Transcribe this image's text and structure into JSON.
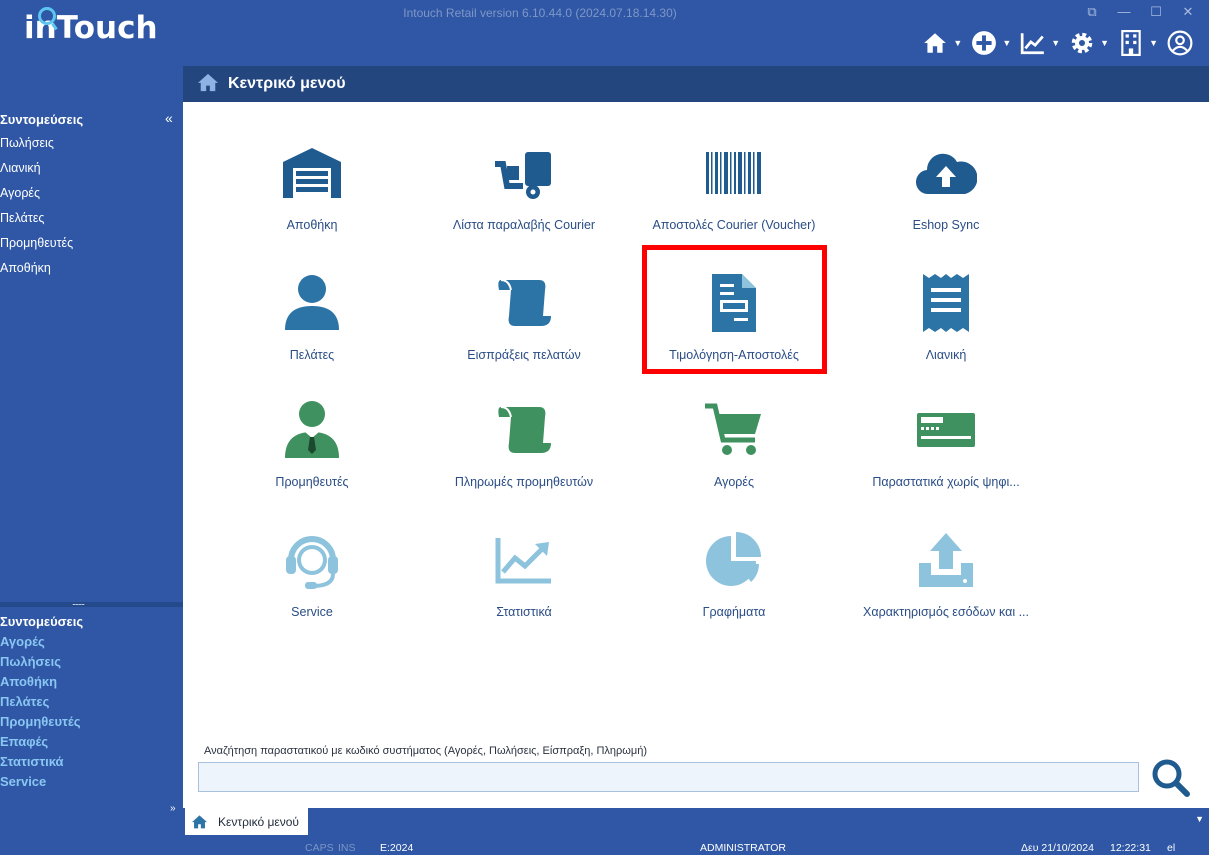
{
  "window": {
    "title": "Intouch Retail version 6.10.44.0 (2024.07.18.14.30)",
    "controls": [
      "restore-down-icon",
      "minimize-icon",
      "maximize-icon",
      "close-icon"
    ]
  },
  "logo": {
    "text": "inTouch"
  },
  "toolbar": {
    "icons": [
      "home-icon",
      "add-icon",
      "chart-icon",
      "gear-icon",
      "building-icon",
      "user-icon"
    ]
  },
  "header": {
    "title": "Κεντρικό μενού"
  },
  "sidebar": {
    "heading": "Συντομεύσεις",
    "collapse_glyph": "«",
    "items": [
      "Πωλήσεις",
      "Λιανική",
      "Αγορές",
      "Πελάτες",
      "Προμηθευτές",
      "Αποθήκη"
    ],
    "splitter_glyph": "........",
    "heading2": "Συντομεύσεις",
    "items2": [
      "Αγορές",
      "Πωλήσεις",
      "Αποθήκη",
      "Πελάτες",
      "Προμηθευτές",
      "Επαφές",
      "Στατιστικά",
      "Service"
    ]
  },
  "tiles": [
    {
      "label": "Αποθήκη",
      "icon": "warehouse-icon",
      "color": "#1f5b8e"
    },
    {
      "label": "Λίστα παραλαβής Courier",
      "icon": "hand-truck-icon",
      "color": "#1f5b8e"
    },
    {
      "label": "Αποστολές Courier (Voucher)",
      "icon": "barcode-icon",
      "color": "#1f5b8e"
    },
    {
      "label": "Eshop Sync",
      "icon": "cloud-upload-icon",
      "color": "#1f5b8e"
    },
    {
      "label": "Πελάτες",
      "icon": "user-icon",
      "color": "#2c73a6"
    },
    {
      "label": "Εισπράξεις πελατών",
      "icon": "scroll-icon",
      "color": "#2c73a6"
    },
    {
      "label": "Τιμολόγηση-Αποστολές",
      "icon": "invoice-icon",
      "color": "#2c73a6"
    },
    {
      "label": "Λιανική",
      "icon": "receipt-icon",
      "color": "#2c73a6"
    },
    {
      "label": "Προμηθευτές",
      "icon": "supplier-icon",
      "color": "#3f9160"
    },
    {
      "label": "Πληρωμές προμηθευτών",
      "icon": "scroll-icon",
      "color": "#3f9160"
    },
    {
      "label": "Αγορές",
      "icon": "cart-icon",
      "color": "#3f9160"
    },
    {
      "label": "Παραστατικά χωρίς ψηφι...",
      "icon": "card-reader-icon",
      "color": "#3f9160"
    },
    {
      "label": "Service",
      "icon": "headset-icon",
      "color": "#8ec3de"
    },
    {
      "label": "Στατιστικά",
      "icon": "line-chart-icon",
      "color": "#8ec3de"
    },
    {
      "label": "Γραφήματα",
      "icon": "pie-chart-icon",
      "color": "#8ec3de"
    },
    {
      "label": "Χαρακτηρισμός εσόδων και ...",
      "icon": "upload-tray-icon",
      "color": "#8ec3de"
    }
  ],
  "search": {
    "label": "Αναζήτηση παραστατικού με κωδικό συστήματος (Αγορές, Πωλήσεις, Είσπραξη, Πληρωμή)",
    "value": "",
    "placeholder": ""
  },
  "tab": {
    "label": "Κεντρικό μενού"
  },
  "tabstrip": {
    "expand_glyph": "»",
    "dropdown_glyph": "▼"
  },
  "status": {
    "caps": "CAPS",
    "ins": "INS",
    "year": "E:2024",
    "user": "ADMINISTRATOR",
    "date": "Δευ 21/10/2024",
    "time": "12:22:31",
    "lang": "el"
  },
  "colors": {
    "chrome": "#2f57a5",
    "header": "#23467f",
    "highlight": "#ff0000"
  }
}
